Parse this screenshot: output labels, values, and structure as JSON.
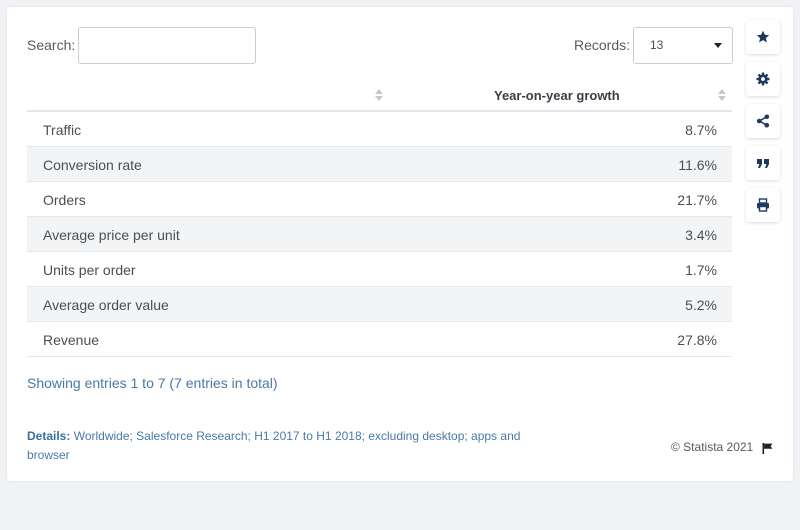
{
  "search": {
    "label": "Search:",
    "value": "",
    "placeholder": ""
  },
  "records": {
    "label": "Records:",
    "selected": "13"
  },
  "table": {
    "columns": [
      "",
      "Year-on-year growth"
    ],
    "rows": [
      {
        "label": "Traffic",
        "value": "8.7%"
      },
      {
        "label": "Conversion rate",
        "value": "11.6%"
      },
      {
        "label": "Orders",
        "value": "21.7%"
      },
      {
        "label": "Average price per unit",
        "value": "3.4%"
      },
      {
        "label": "Units per order",
        "value": "1.7%"
      },
      {
        "label": "Average order value",
        "value": "5.2%"
      },
      {
        "label": "Revenue",
        "value": "27.8%"
      }
    ]
  },
  "showing": "Showing entries 1 to 7 (7 entries in total)",
  "details": {
    "label": "Details:",
    "text": "Worldwide; Salesforce Research; H1 2017 to H1 2018; excluding desktop; apps and browser"
  },
  "copyright": "© Statista 2021",
  "sidebar": {
    "icons": [
      "star-icon",
      "gear-icon",
      "share-icon",
      "quote-icon",
      "print-icon"
    ]
  },
  "colors": {
    "accent": "#4a79a8",
    "sidebar_icon": "#1e3a5f",
    "row_alt": "#f2f4f6"
  }
}
